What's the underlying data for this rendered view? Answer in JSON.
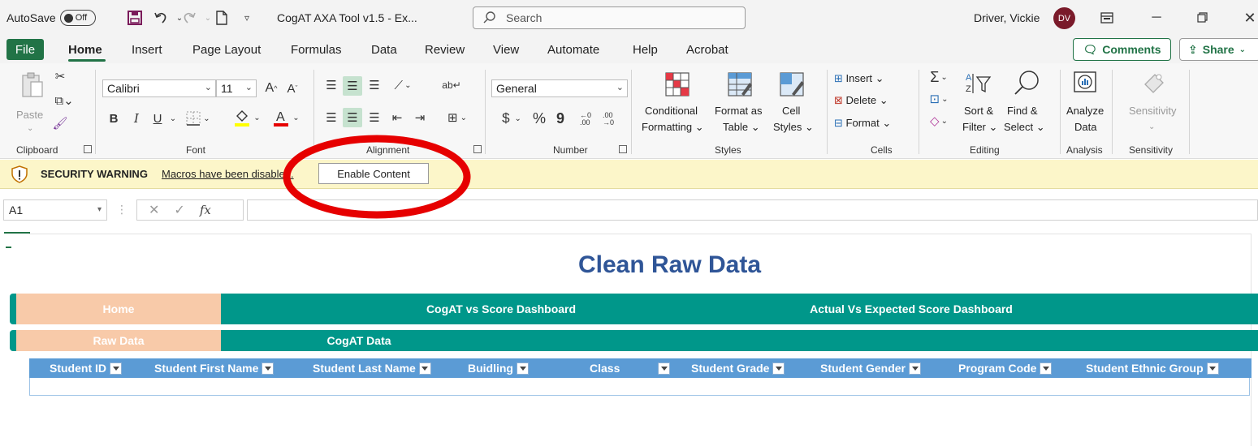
{
  "titlebar": {
    "autosave_label": "AutoSave",
    "autosave_state": "Off",
    "doc_title": "CogAT AXA Tool v1.5  -  Ex...",
    "search_placeholder": "Search",
    "user_name": "Driver, Vickie",
    "user_initials": "DV",
    "avatar_color": "#7a1a2a"
  },
  "menu": {
    "tabs": [
      "File",
      "Home",
      "Insert",
      "Page Layout",
      "Formulas",
      "Data",
      "Review",
      "View",
      "Automate",
      "Help",
      "Acrobat"
    ],
    "comments_label": "Comments",
    "share_label": "Share"
  },
  "ribbon": {
    "clipboard": {
      "paste": "Paste",
      "group": "Clipboard"
    },
    "font": {
      "name": "Calibri",
      "size": "11",
      "bold": "B",
      "italic": "I",
      "underline": "U",
      "grow": "A",
      "shrink": "A",
      "group": "Font"
    },
    "alignment": {
      "group": "Alignment"
    },
    "number": {
      "format": "General",
      "currency": "$",
      "percent": "%",
      "comma": "9",
      "inc_decimal": "←0 .00",
      "dec_decimal": ".00 →0",
      "group": "Number"
    },
    "styles": {
      "conditional_1": "Conditional",
      "conditional_2": "Formatting",
      "format_as_1": "Format as",
      "format_as_2": "Table",
      "cell_styles_1": "Cell",
      "cell_styles_2": "Styles",
      "group": "Styles"
    },
    "cells": {
      "insert": "Insert",
      "delete": "Delete",
      "format": "Format",
      "group": "Cells"
    },
    "editing": {
      "sigma": "Σ",
      "sort_1": "Sort &",
      "sort_2": "Filter",
      "find_1": "Find &",
      "find_2": "Select",
      "group": "Editing"
    },
    "analysis": {
      "analyze_1": "Analyze",
      "analyze_2": "Data",
      "group": "Analysis"
    },
    "sensitivity": {
      "label": "Sensitivity",
      "group": "Sensitivity"
    },
    "accent_color": "#217346"
  },
  "security": {
    "title": "SECURITY WARNING",
    "message": "Macros have been disabled.",
    "button": "Enable Content",
    "bar_color": "#fcf6c9",
    "annotation_color": "#e60000"
  },
  "formula": {
    "cell_ref": "A1",
    "fx": "fx",
    "value": ""
  },
  "sheet": {
    "title": "Clean Raw Data",
    "nav_row1": {
      "home": "Home",
      "cogat_vs_score": "CogAT vs Score Dashboard",
      "actual_vs_expected": "Actual Vs Expected Score Dashboard"
    },
    "nav_row2": {
      "raw_data": "Raw Data",
      "cogat_data": "CogAT Data"
    },
    "columns": [
      "Student ID",
      "Student First Name",
      "Student Last Name",
      "Buidling",
      "Class",
      "Student Grade",
      "Student Gender",
      "Program Code",
      "Student Ethnic Group"
    ],
    "header_color": "#5b9bd5",
    "nav_teal": "#00978a",
    "nav_peach": "#f8caa9",
    "title_color": "#2f5597"
  }
}
